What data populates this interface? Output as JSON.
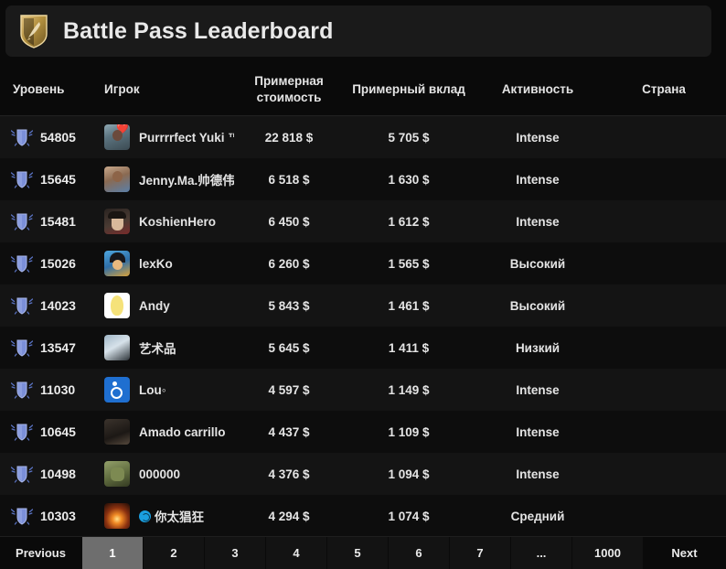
{
  "header": {
    "title": "Battle Pass Leaderboard",
    "logo_icon": "dota-battle-pass-shield-icon"
  },
  "table": {
    "columns": [
      {
        "key": "level",
        "label": "Уровень"
      },
      {
        "key": "player",
        "label": "Игрок"
      },
      {
        "key": "value",
        "label": "Примерная стоимость"
      },
      {
        "key": "contrib",
        "label": "Примерный вклад"
      },
      {
        "key": "activity",
        "label": "Активность"
      },
      {
        "key": "country",
        "label": "Страна"
      }
    ],
    "rows": [
      {
        "level": "54805",
        "player": "Purrrrfect Yuki ™",
        "value": "22 818 $",
        "contrib": "5 705 $",
        "activity": "Intense",
        "country": "",
        "avatar": "photo-woman-heart-avatar",
        "badge": ""
      },
      {
        "level": "15645",
        "player": "Jenny.Ma.帅德伟",
        "value": "6 518 $",
        "contrib": "1 630 $",
        "activity": "Intense",
        "country": "",
        "avatar": "photo-man-blue-shirt-avatar",
        "badge": ""
      },
      {
        "level": "15481",
        "player": "KoshienHero",
        "value": "6 450 $",
        "contrib": "1 612 $",
        "activity": "Intense",
        "country": "",
        "avatar": "anime-cap-character-avatar",
        "badge": ""
      },
      {
        "level": "15026",
        "player": "lexKo",
        "value": "6 260 $",
        "contrib": "1 565 $",
        "activity": "Высокий",
        "country": "",
        "avatar": "goku-anime-avatar",
        "badge": ""
      },
      {
        "level": "14023",
        "player": "Andy",
        "value": "5 843 $",
        "contrib": "1 461 $",
        "activity": "Высокий",
        "country": "",
        "avatar": "yellow-duck-white-bg-avatar",
        "badge": ""
      },
      {
        "level": "13547",
        "player": "艺术品",
        "value": "5 645 $",
        "contrib": "1 411 $",
        "activity": "Низкий",
        "country": "",
        "avatar": "car-snow-photo-avatar",
        "badge": ""
      },
      {
        "level": "11030",
        "player": "Lou◦",
        "value": "4 597 $",
        "contrib": "1 149 $",
        "activity": "Intense",
        "country": "",
        "avatar": "wheelchair-symbol-avatar",
        "badge": ""
      },
      {
        "level": "10645",
        "player": "Amado carrillo",
        "value": "4 437 $",
        "contrib": "1 109 $",
        "activity": "Intense",
        "country": "",
        "avatar": "dark-photo-person-avatar",
        "badge": ""
      },
      {
        "level": "10498",
        "player": "000000",
        "value": "4 376 $",
        "contrib": "1 094 $",
        "activity": "Intense",
        "country": "",
        "avatar": "green-ogre-face-avatar",
        "badge": ""
      },
      {
        "level": "10303",
        "player": "你太猖狂",
        "value": "4 294 $",
        "contrib": "1 074 $",
        "activity": "Средний",
        "country": "",
        "avatar": "fire-explosion-avatar",
        "badge": "circle-blue-emoji"
      }
    ]
  },
  "pagination": {
    "previous_label": "Previous",
    "next_label": "Next",
    "pages": [
      "1",
      "2",
      "3",
      "4",
      "5",
      "6",
      "7",
      "...",
      "1000"
    ],
    "active_page": "1"
  },
  "colors": {
    "background": "#0a0a0a",
    "card": "#1a1a1a",
    "row_odd": "#141414",
    "row_even": "#0d0d0d",
    "text": "#e4e4e4",
    "active_page": "#6e6e6e",
    "badge_blue": "#6f86d6",
    "logo_gold": "#c9a24a"
  }
}
